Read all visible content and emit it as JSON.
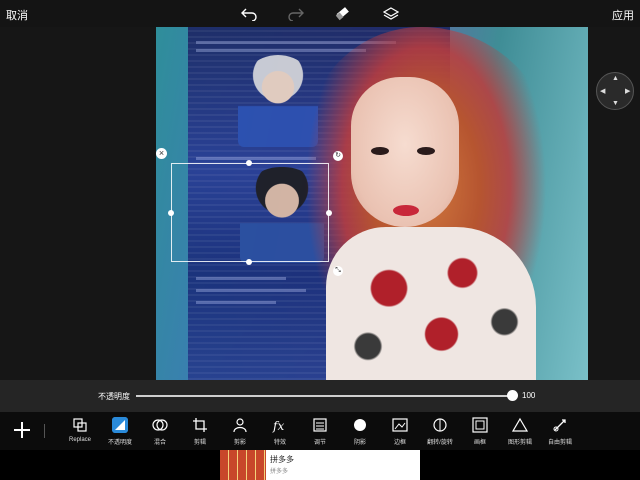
{
  "topbar": {
    "cancel_label": "取消",
    "apply_label": "应用",
    "icons": [
      "undo-icon",
      "redo-icon",
      "eraser-icon",
      "layers-icon"
    ]
  },
  "slider": {
    "label": "不透明度",
    "value": "100",
    "fraction": 1.0
  },
  "toolbar": {
    "tools": [
      {
        "label": "Replace",
        "icon": "replace-icon",
        "active": false
      },
      {
        "label": "不透明度",
        "icon": "opacity-icon",
        "active": true
      },
      {
        "label": "混合",
        "icon": "blend-icon",
        "active": false
      },
      {
        "label": "剪辑",
        "icon": "crop-icon",
        "active": false
      },
      {
        "label": "剪影",
        "icon": "silhouette-icon",
        "active": false
      },
      {
        "label": "特效",
        "icon": "fx-icon",
        "active": false
      },
      {
        "label": "调节",
        "icon": "adjust-icon",
        "active": false
      },
      {
        "label": "阴影",
        "icon": "shadow-icon",
        "active": false
      },
      {
        "label": "边框",
        "icon": "border-icon",
        "active": false
      },
      {
        "label": "翻转/旋转",
        "icon": "flip-rotate-icon",
        "active": false
      },
      {
        "label": "画框",
        "icon": "frame-icon",
        "active": false
      },
      {
        "label": "图形剪辑",
        "icon": "shape-crop-icon",
        "active": false
      },
      {
        "label": "自由剪辑",
        "icon": "free-crop-icon",
        "active": false
      }
    ]
  },
  "ad": {
    "title": "拼多多",
    "subtitle": "拼多多"
  }
}
